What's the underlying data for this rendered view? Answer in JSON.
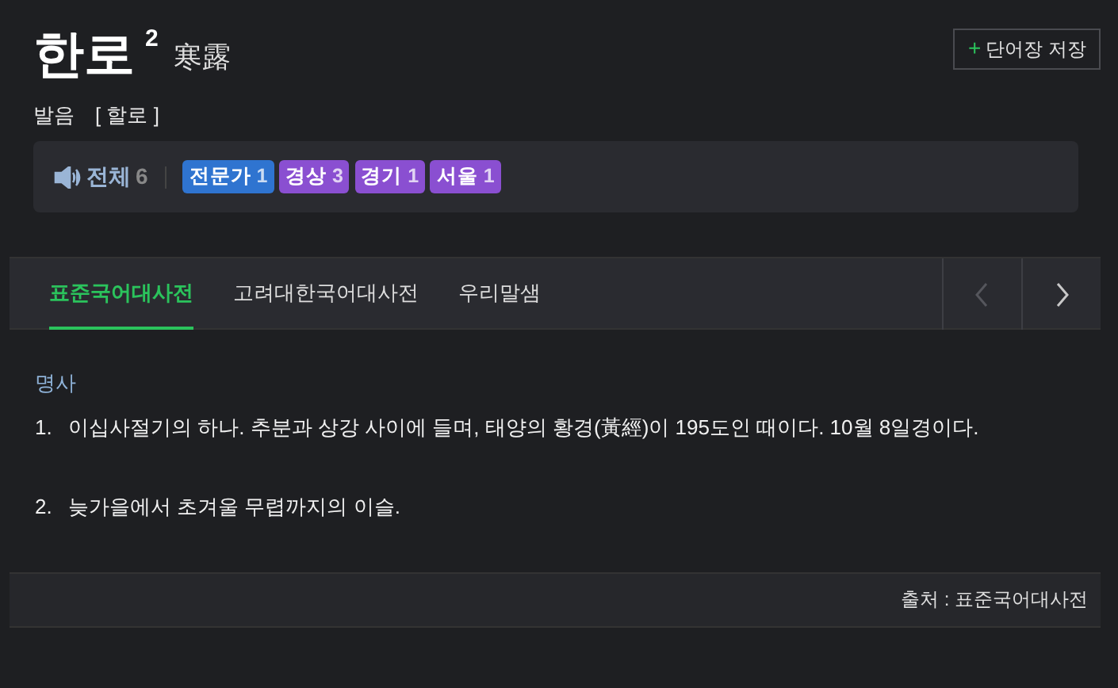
{
  "save_button": {
    "icon": "+",
    "label": "단어장 저장"
  },
  "headword": {
    "word": "한로",
    "homonym": "2",
    "hanja": "寒露"
  },
  "pronunciation": {
    "label": "발음",
    "value": "[ 할로 ]"
  },
  "audio": {
    "label": "전체",
    "count": "6",
    "tags": [
      {
        "label": "전문가",
        "count": "1",
        "color": "#2f74d0"
      },
      {
        "label": "경상",
        "count": "3",
        "color": "#8a4fd1"
      },
      {
        "label": "경기",
        "count": "1",
        "color": "#8a4fd1"
      },
      {
        "label": "서울",
        "count": "1",
        "color": "#8a4fd1"
      }
    ]
  },
  "tabs": [
    {
      "label": "표준국어대사전",
      "selected": true
    },
    {
      "label": "고려대한국어대사전",
      "selected": false
    },
    {
      "label": "우리말샘",
      "selected": false
    }
  ],
  "nav": {
    "prev_disabled": true,
    "next_disabled": false
  },
  "part_of_speech": "명사",
  "senses": [
    {
      "number": "1.",
      "text": "이십사절기의 하나. 추분과 상강 사이에 들며, 태양의 황경(黃經)이 195도인 때이다. 10월 8일경이다."
    },
    {
      "number": "2.",
      "text": "늦가을에서 초겨울 무렵까지의 이슬."
    }
  ],
  "source": "출처 : 표준국어대사전"
}
